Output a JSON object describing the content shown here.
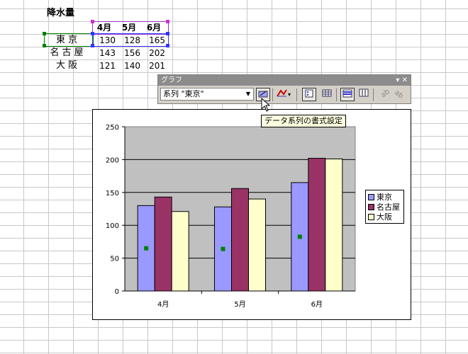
{
  "sheet": {
    "title": "降水量",
    "months": [
      "4月",
      "5月",
      "6月"
    ],
    "rows": [
      {
        "label": "東京",
        "values": [
          "130",
          "128",
          "165"
        ]
      },
      {
        "label": "名古屋",
        "values": [
          "143",
          "156",
          "202"
        ]
      },
      {
        "label": "大阪",
        "values": [
          "121",
          "140",
          "201"
        ]
      }
    ]
  },
  "toolbar": {
    "title": "グラフ",
    "controls": "▾ ✕",
    "series_select": "系列 \"東京\"",
    "tooltip": "データ系列の書式設定"
  },
  "colors": {
    "tokyo": "#9999ff",
    "nagoya": "#993366",
    "osaka": "#ffffcc",
    "plot_bg": "#c0c0c0",
    "marker": "#008000"
  },
  "chart_data": {
    "type": "bar",
    "categories": [
      "4月",
      "5月",
      "6月"
    ],
    "series": [
      {
        "name": "東京",
        "values": [
          130,
          128,
          165
        ]
      },
      {
        "name": "名古屋",
        "values": [
          143,
          156,
          202
        ]
      },
      {
        "name": "大阪",
        "values": [
          121,
          140,
          201
        ]
      }
    ],
    "ylim": [
      0,
      250
    ],
    "yticks": [
      "0",
      "50",
      "100",
      "150",
      "200",
      "250"
    ],
    "grid": true,
    "legend": "right",
    "selected_series": "東京"
  }
}
